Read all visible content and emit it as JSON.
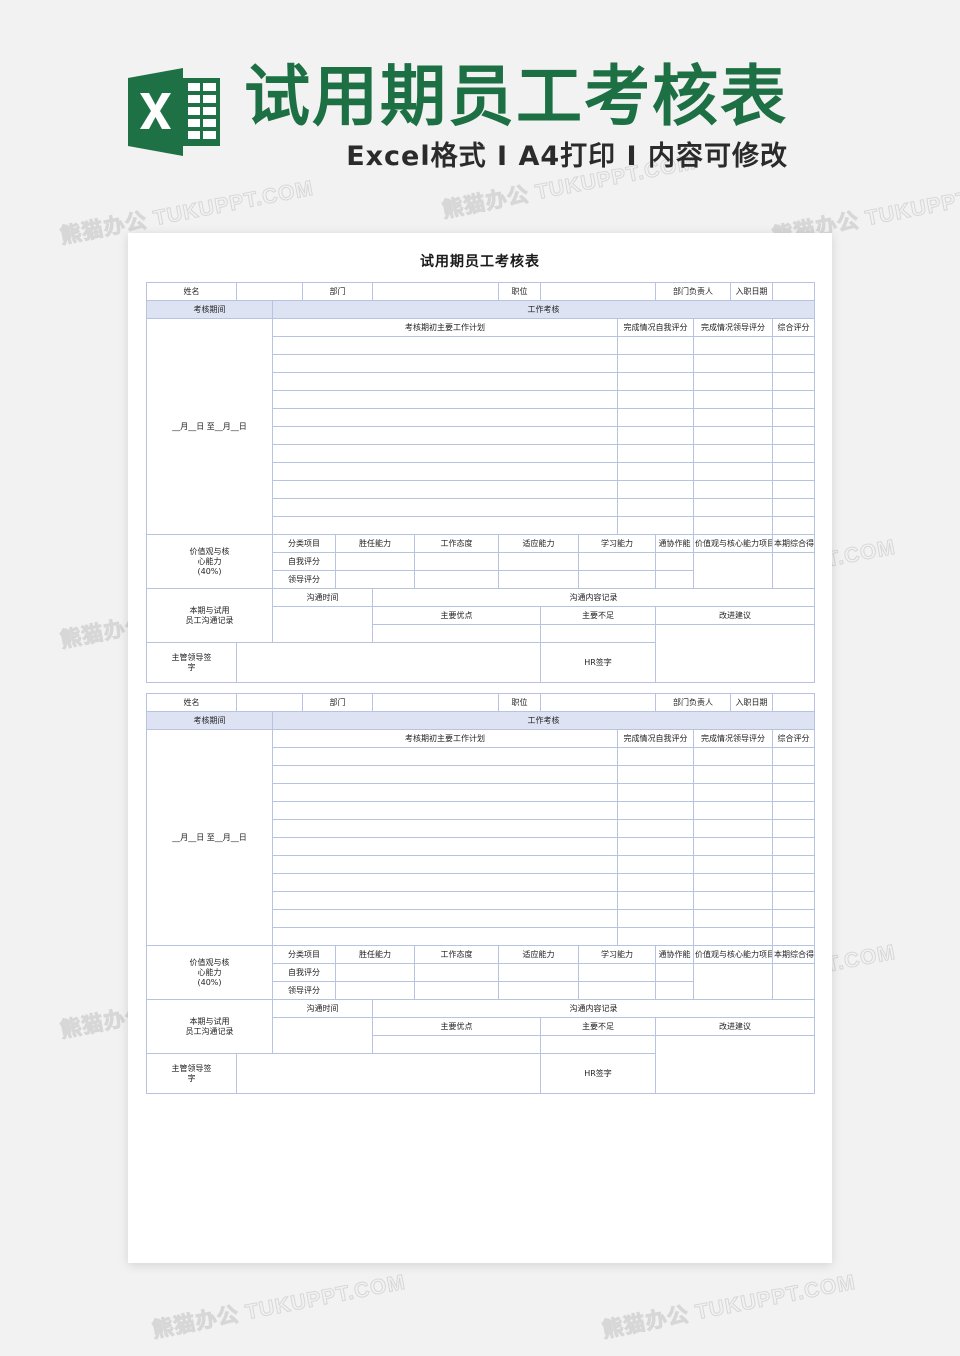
{
  "banner": {
    "logo": "excel-logo",
    "title": "试用期员工考核表",
    "subtitle": "Excel格式 Ⅰ A4打印 Ⅰ 内容可修改",
    "title_color": "#1d7044",
    "logo_color": "#1e7145"
  },
  "watermark": {
    "text": "熊猫办公 TUKUPPT.COM"
  },
  "document": {
    "title": "试用期员工考核表",
    "page_bg": "#ffffff",
    "grid_color": "#b7c3e0",
    "band_color": "#dde3f2"
  },
  "form": {
    "info": {
      "name_label": "姓名",
      "dept_label": "部门",
      "position_label": "职位",
      "dept_head_label": "部门负责人",
      "hire_date_label": "入职日期"
    },
    "period_label": "考核期间",
    "work_review_label": "工作考核",
    "plan_header": {
      "plan": "考核期初主要工作计划",
      "self_score": "完成情况自我评分",
      "leader_score": "完成情况领导评分",
      "total_score": "综合评分"
    },
    "period_value": "__月__日\n至__月__日",
    "empty_plan_rows": 11,
    "competency": {
      "title": "价值观与核\n心能力\n(40%)",
      "row_labels": [
        "分类项目",
        "自我评分",
        "领导评分"
      ],
      "items": [
        "胜任能力",
        "工作态度",
        "适应能力",
        "学习能力",
        "通协作能"
      ],
      "average_label": "价值观与核心能力项目平均得分",
      "period_total_label": "本期综合得分"
    },
    "communication": {
      "side_label": "本期与试用\n员工沟通记录",
      "time_label": "沟通时间",
      "content_label": "沟通内容记录",
      "columns": [
        "主要优点",
        "主要不足",
        "改进建议"
      ],
      "supervisor_sign_label": "主管领导签\n字",
      "hr_sign_label": "HR签字"
    }
  },
  "tables": [
    {
      "id": "table-1"
    },
    {
      "id": "table-2"
    }
  ]
}
